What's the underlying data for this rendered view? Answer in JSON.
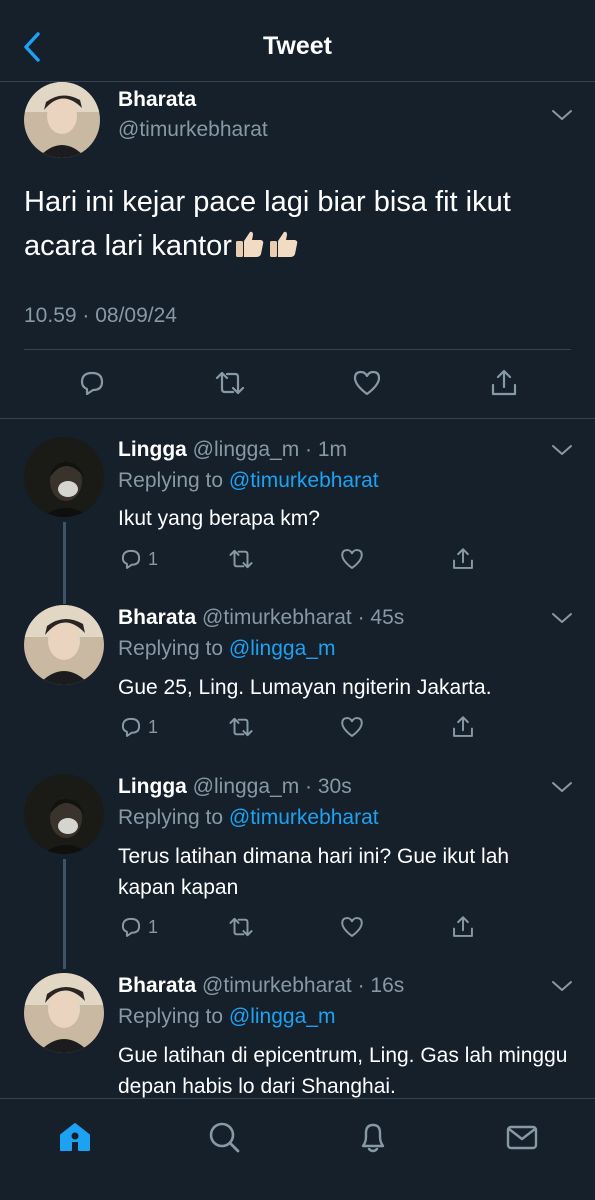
{
  "header": {
    "title": "Tweet"
  },
  "main_tweet": {
    "name": "Bharata",
    "handle": "@timurkebharat",
    "text": "Hari ini kejar pace lagi biar bisa fit ikut acara lari kantor",
    "emoji": "👍🏻👍🏻",
    "timestamp": "10.59 · 08/09/24"
  },
  "replies": [
    {
      "name": "Lingga",
      "meta": "@lingga_m · 1m",
      "replying_prefix": "Replying to ",
      "replying_to": "@timurkebharat",
      "text": "Ikut yang berapa km?",
      "reply_count": "1"
    },
    {
      "name": "Bharata",
      "meta": "@timurkebharat · 45s",
      "replying_prefix": "Replying to ",
      "replying_to": "@lingga_m",
      "text": "Gue 25, Ling. Lumayan ngiterin Jakarta.",
      "reply_count": "1"
    },
    {
      "name": "Lingga",
      "meta": "@lingga_m · 30s",
      "replying_prefix": "Replying to ",
      "replying_to": "@timurkebharat",
      "text": "Terus latihan dimana hari ini? Gue ikut lah kapan kapan",
      "reply_count": "1"
    },
    {
      "name": "Bharata",
      "meta": "@timurkebharat · 16s",
      "replying_prefix": "Replying to ",
      "replying_to": "@lingga_m",
      "text": "Gue latihan di epicentrum, Ling. Gas lah minggu depan habis lo dari Shanghai.",
      "reply_count": ""
    }
  ],
  "icons": {
    "back": "chevron-left-icon",
    "more": "chevron-down-icon",
    "reply": "reply-icon",
    "retweet": "retweet-icon",
    "like": "heart-icon",
    "share": "share-icon",
    "home": "home-icon",
    "search": "search-icon",
    "notifications": "bell-icon",
    "messages": "mail-icon"
  },
  "colors": {
    "background": "#15202b",
    "accent": "#1da1f2",
    "secondary_text": "#8899a6",
    "divider": "#38444d"
  }
}
